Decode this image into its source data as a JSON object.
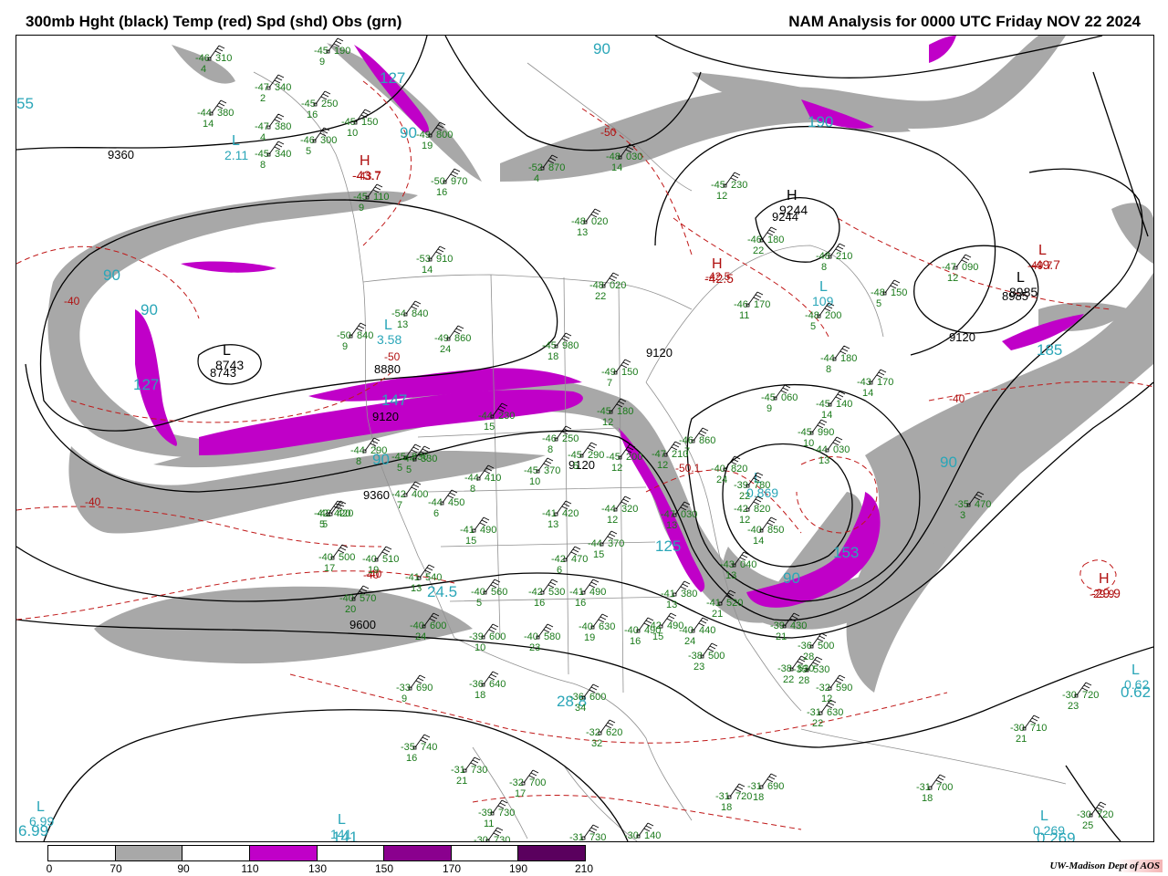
{
  "header": {
    "left_title": "300mb Hght (black) Temp (red) Spd (shd) Obs (grn)",
    "right_title": "NAM Analysis for 0000 UTC Friday  NOV 22 2024"
  },
  "colors": {
    "height_contour": "#000000",
    "temperature_contour": "#c01818",
    "speed_shade_70_90": "#a8a8a8",
    "speed_shade_110_130": "#c000c8",
    "speed_shade_150_170": "#8a008e",
    "speed_shade_190_210": "#5a005e",
    "obs": "#1a7a1a",
    "speed_label": "#2aa6b8",
    "political_boundaries": "#909090"
  },
  "legend": {
    "ticks": [
      "0",
      "70",
      "90",
      "110",
      "130",
      "150",
      "170",
      "190",
      "210"
    ],
    "fills": [
      "#ffffff",
      "#a8a8a8",
      "#ffffff",
      "#c000c8",
      "#ffffff",
      "#8a008e",
      "#ffffff",
      "#5a005e"
    ]
  },
  "credit": "UW-Madison  Dept of AOS",
  "height_labels": [
    "9360",
    "8743",
    "8880",
    "9120",
    "9120",
    "9244",
    "8985",
    "9120",
    "9360",
    "9600",
    "9120"
  ],
  "temp_labels": [
    "-40",
    "-40",
    "-50",
    "-43.7",
    "-42.5",
    "-50.1",
    "-49.7",
    "-29.9",
    "-40",
    "-40",
    "-50",
    "-40"
  ],
  "speed_labels": [
    "55",
    "127",
    "90",
    "90",
    "90",
    "127",
    "90",
    "147",
    "90",
    "185",
    "24.5",
    "28.8",
    "90",
    "190",
    "125",
    "90",
    "153",
    "0.62",
    "6.99",
    "141",
    "0.269",
    "2.11",
    "3.58",
    "109",
    "0.869"
  ],
  "centers": [
    {
      "kind": "L",
      "value": "2.11",
      "color": "#2aa6b8"
    },
    {
      "kind": "H",
      "value": "-43.7",
      "color": "#b01010"
    },
    {
      "kind": "L",
      "value": "8743",
      "color": "#000000"
    },
    {
      "kind": "L",
      "value": "3.58",
      "color": "#2aa6b8"
    },
    {
      "kind": "H",
      "value": "-42.5",
      "color": "#b01010"
    },
    {
      "kind": "H",
      "value": "9244",
      "color": "#000000"
    },
    {
      "kind": "L",
      "value": "109",
      "color": "#2aa6b8"
    },
    {
      "kind": "L",
      "value": "8985",
      "color": "#000000"
    },
    {
      "kind": "L",
      "value": "-49.7",
      "color": "#b01010"
    },
    {
      "kind": "L",
      "value": "0.869",
      "color": "#2aa6b8"
    },
    {
      "kind": "H",
      "value": "-29.9",
      "color": "#b01010"
    },
    {
      "kind": "L",
      "value": "6.99",
      "color": "#2aa6b8"
    },
    {
      "kind": "L",
      "value": "141",
      "color": "#2aa6b8"
    },
    {
      "kind": "L",
      "value": "0.269",
      "color": "#2aa6b8"
    },
    {
      "kind": "L",
      "value": "0.62",
      "color": "#2aa6b8"
    }
  ],
  "stations": [
    {
      "t": "-46",
      "d": "4",
      "h": "310"
    },
    {
      "t": "-47",
      "d": "2",
      "h": "340"
    },
    {
      "t": "-44",
      "d": "14",
      "h": "380"
    },
    {
      "t": "-47",
      "d": "4",
      "h": "380"
    },
    {
      "t": "-45",
      "d": "16",
      "h": "250"
    },
    {
      "t": "-45",
      "d": "10",
      "h": "150"
    },
    {
      "t": "-45",
      "d": "9",
      "h": "190"
    },
    {
      "t": "-45",
      "d": "8",
      "h": "340"
    },
    {
      "t": "-46",
      "d": "5",
      "h": "300"
    },
    {
      "t": "-49",
      "d": "19",
      "h": "800"
    },
    {
      "t": "-50",
      "d": "16",
      "h": "970"
    },
    {
      "t": "-52",
      "d": "4",
      "h": "870"
    },
    {
      "t": "-45",
      "d": "9",
      "h": "110"
    },
    {
      "t": "-48",
      "d": "14",
      "h": "030"
    },
    {
      "t": "-45",
      "d": "12",
      "h": "230"
    },
    {
      "t": "-48",
      "d": "13",
      "h": "020"
    },
    {
      "t": "-46",
      "d": "22",
      "h": "180"
    },
    {
      "t": "-48",
      "d": "8",
      "h": "210"
    },
    {
      "t": "-47",
      "d": "12",
      "h": "090"
    },
    {
      "t": "-53",
      "d": "14",
      "h": "910"
    },
    {
      "t": "-48",
      "d": "22",
      "h": "020"
    },
    {
      "t": "-48",
      "d": "5",
      "h": "150"
    },
    {
      "t": "-46",
      "d": "11",
      "h": "170"
    },
    {
      "t": "-48",
      "d": "5",
      "h": "200"
    },
    {
      "t": "-54",
      "d": "13",
      "h": "840"
    },
    {
      "t": "-50",
      "d": "9",
      "h": "840"
    },
    {
      "t": "-49",
      "d": "24",
      "h": "860"
    },
    {
      "t": "-45",
      "d": "18",
      "h": "980"
    },
    {
      "t": "-49",
      "d": "7",
      "h": "150"
    },
    {
      "t": "-44",
      "d": "8",
      "h": "180"
    },
    {
      "t": "-43",
      "d": "14",
      "h": "170"
    },
    {
      "t": "-45",
      "d": "9",
      "h": "060"
    },
    {
      "t": "-45",
      "d": "14",
      "h": "140"
    },
    {
      "t": "-44",
      "d": "15",
      "h": "230"
    },
    {
      "t": "-45",
      "d": "12",
      "h": "180"
    },
    {
      "t": "-45",
      "d": "10",
      "h": "990"
    },
    {
      "t": "-44",
      "d": "13",
      "h": "030"
    },
    {
      "t": "-44",
      "d": "8",
      "h": "290"
    },
    {
      "t": "-45",
      "d": "5",
      "h": "330"
    },
    {
      "t": "-45",
      "d": "5",
      "h": "290"
    },
    {
      "t": "-46",
      "d": "8",
      "h": "250"
    },
    {
      "t": "-45",
      "d": "10",
      "h": "370"
    },
    {
      "t": "-45",
      "d": "12",
      "h": "200"
    },
    {
      "t": "-47",
      "d": "12",
      "h": "210"
    },
    {
      "t": "-46",
      "d": "7",
      "h": "860"
    },
    {
      "t": "-40",
      "d": "24",
      "h": "820"
    },
    {
      "t": "-39",
      "d": "22",
      "h": "780"
    },
    {
      "t": "-42",
      "d": "7",
      "h": "400"
    },
    {
      "t": "-44",
      "d": "6",
      "h": "450"
    },
    {
      "t": "-44",
      "d": "8",
      "h": "410"
    },
    {
      "t": "-42",
      "d": "5",
      "h": "420"
    },
    {
      "t": "-41",
      "d": "13",
      "h": "420"
    },
    {
      "t": "-44",
      "d": "12",
      "h": "320"
    },
    {
      "t": "-47",
      "d": "13",
      "h": "030"
    },
    {
      "t": "-42",
      "d": "12",
      "h": "820"
    },
    {
      "t": "-40",
      "d": "14",
      "h": "850"
    },
    {
      "t": "-44",
      "d": "15",
      "h": "370"
    },
    {
      "t": "-41",
      "d": "15",
      "h": "490"
    },
    {
      "t": "-40",
      "d": "17",
      "h": "500"
    },
    {
      "t": "-40",
      "d": "19",
      "h": "510"
    },
    {
      "t": "-42",
      "d": "6",
      "h": "470"
    },
    {
      "t": "-41",
      "d": "13",
      "h": "540"
    },
    {
      "t": "-40",
      "d": "5",
      "h": "560"
    },
    {
      "t": "-42",
      "d": "16",
      "h": "530"
    },
    {
      "t": "-41",
      "d": "16",
      "h": "490"
    },
    {
      "t": "-40",
      "d": "20",
      "h": "570"
    },
    {
      "t": "-41",
      "d": "13",
      "h": "380"
    },
    {
      "t": "-42",
      "d": "15",
      "h": "490"
    },
    {
      "t": "-41",
      "d": "21",
      "h": "520"
    },
    {
      "t": "-43",
      "d": "13",
      "h": "040"
    },
    {
      "t": "-40",
      "d": "24",
      "h": "600"
    },
    {
      "t": "-39",
      "d": "10",
      "h": "600"
    },
    {
      "t": "-40",
      "d": "23",
      "h": "580"
    },
    {
      "t": "-40",
      "d": "19",
      "h": "630"
    },
    {
      "t": "-40",
      "d": "16",
      "h": "490"
    },
    {
      "t": "-40",
      "d": "24",
      "h": "440"
    },
    {
      "t": "-39",
      "d": "21",
      "h": "430"
    },
    {
      "t": "-38",
      "d": "22",
      "h": "530"
    },
    {
      "t": "-38",
      "d": "23",
      "h": "500"
    },
    {
      "t": "-36",
      "d": "28",
      "h": "500"
    },
    {
      "t": "-35",
      "d": "28",
      "h": "530"
    },
    {
      "t": "-33",
      "d": "9",
      "h": "690"
    },
    {
      "t": "-36",
      "d": "18",
      "h": "640"
    },
    {
      "t": "-36",
      "d": "34",
      "h": "600"
    },
    {
      "t": "-32",
      "d": "32",
      "h": "620"
    },
    {
      "t": "-32",
      "d": "12",
      "h": "590"
    },
    {
      "t": "-31",
      "d": "22",
      "h": "630"
    },
    {
      "t": "-35",
      "d": "16",
      "h": "740"
    },
    {
      "t": "-31",
      "d": "21",
      "h": "730"
    },
    {
      "t": "-32",
      "d": "17",
      "h": "700"
    },
    {
      "t": "-39",
      "d": "11",
      "h": "730"
    },
    {
      "t": "-30",
      "d": "18",
      "h": "730"
    },
    {
      "t": "-31",
      "d": "18",
      "h": "730"
    },
    {
      "t": "-30",
      "d": "18",
      "h": "140"
    },
    {
      "t": "-31",
      "d": "18",
      "h": "720"
    },
    {
      "t": "-31",
      "d": "18",
      "h": "690"
    },
    {
      "t": "-31",
      "d": "18",
      "h": "700"
    },
    {
      "t": "-30",
      "d": "23",
      "h": "720"
    },
    {
      "t": "-30",
      "d": "21",
      "h": "710"
    },
    {
      "t": "-30",
      "d": "25",
      "h": "720"
    },
    {
      "t": "-35",
      "d": "3",
      "h": "470"
    },
    {
      "t": "-44",
      "d": "5",
      "h": "330"
    },
    {
      "t": "-42",
      "d": "5",
      "h": "420"
    }
  ]
}
